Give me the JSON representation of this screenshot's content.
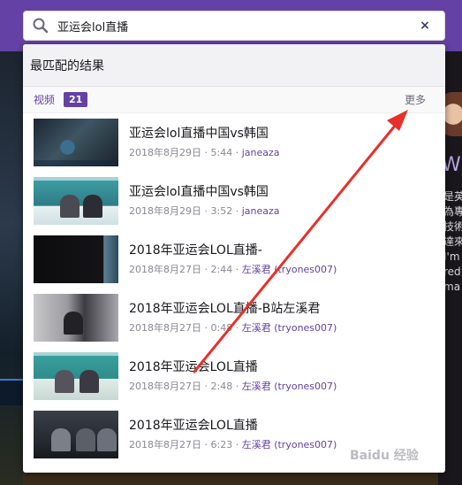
{
  "search": {
    "query": "亚运会lol直播",
    "clear_symbol": "×"
  },
  "panel": {
    "header": "最匹配的结果"
  },
  "section": {
    "label": "视频",
    "count": "21",
    "more": "更多"
  },
  "results": [
    {
      "title": "亚运会lol直播中国vs韩国",
      "date": "2018年8月29日",
      "duration": "5:44",
      "channel": "janeaza",
      "thumb": "dark-game"
    },
    {
      "title": "亚运会lol直播中国vs韩国",
      "date": "2018年8月29日",
      "duration": "3:52",
      "channel": "janeaza",
      "thumb": "stage-teal"
    },
    {
      "title": "2018年亚运会LOL直播-",
      "date": "2018年8月27日",
      "duration": "2:44",
      "channel": "左溪君 (tryones007)",
      "thumb": "black-edge"
    },
    {
      "title": "2018年亚运会LOL直播-B站左溪君",
      "date": "2018年8月27日",
      "duration": "0:48",
      "channel": "左溪君 (tryones007)",
      "thumb": "player-gray"
    },
    {
      "title": "2018年亚运会LOL直播",
      "date": "2018年8月27日",
      "duration": "2:48",
      "channel": "左溪君 (tryones007)",
      "thumb": "stage-teal"
    },
    {
      "title": "2018年亚运会LOL直播",
      "date": "2018年8月27日",
      "duration": "6:23",
      "channel": "左溪君 (tryones007)",
      "thumb": "dark-people"
    }
  ],
  "background": {
    "right_title": "Wir",
    "right_lines": [
      "是英",
      "為專",
      "技術",
      "達來",
      "I'm",
      "red",
      "ma"
    ]
  },
  "watermark": "Baidu 经验",
  "colors": {
    "brand": "#6441a4",
    "annotation": "#e8302a"
  }
}
